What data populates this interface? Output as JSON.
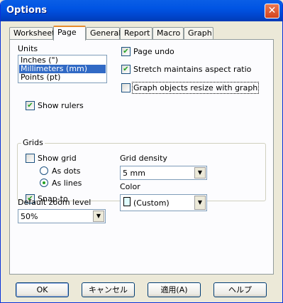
{
  "window": {
    "title": "Options",
    "close_glyph": "✕"
  },
  "tabs": [
    {
      "label": "Worksheet",
      "active": false
    },
    {
      "label": "Page",
      "active": true
    },
    {
      "label": "General",
      "active": false
    },
    {
      "label": "Report",
      "active": false
    },
    {
      "label": "Macro",
      "active": false
    },
    {
      "label": "Graph",
      "active": false
    }
  ],
  "units": {
    "label": "Units",
    "items": [
      "Inches (\")",
      "Millimeters (mm)",
      "Points (pt)"
    ],
    "selected": "Millimeters (mm)"
  },
  "options": {
    "page_undo": {
      "label": "Page undo",
      "checked": true
    },
    "stretch_aspect": {
      "label": "Stretch maintains aspect ratio",
      "checked": true
    },
    "graph_resize": {
      "label": "Graph objects resize with graph",
      "checked": false
    },
    "show_rulers": {
      "label": "Show rulers",
      "checked": true
    }
  },
  "grids": {
    "title": "Grids",
    "show_grid": {
      "label": "Show grid",
      "checked": false
    },
    "as_dots": {
      "label": "As dots",
      "selected": false
    },
    "as_lines": {
      "label": "As lines",
      "selected": true
    },
    "snap_to": {
      "label": "Snap-to",
      "checked": true
    },
    "density_label": "Grid density",
    "density_value": "5 mm",
    "color_label": "Color",
    "color_value": "(Custom)",
    "swatch_color": "#dffdfd"
  },
  "zoom": {
    "label": "Default zoom level",
    "value": "50%"
  },
  "buttons": {
    "ok": "OK",
    "cancel": "キャンセル",
    "apply": "適用(A)",
    "help": "ヘルプ"
  },
  "checkmark": "✔",
  "dropdown_glyph": "▼"
}
